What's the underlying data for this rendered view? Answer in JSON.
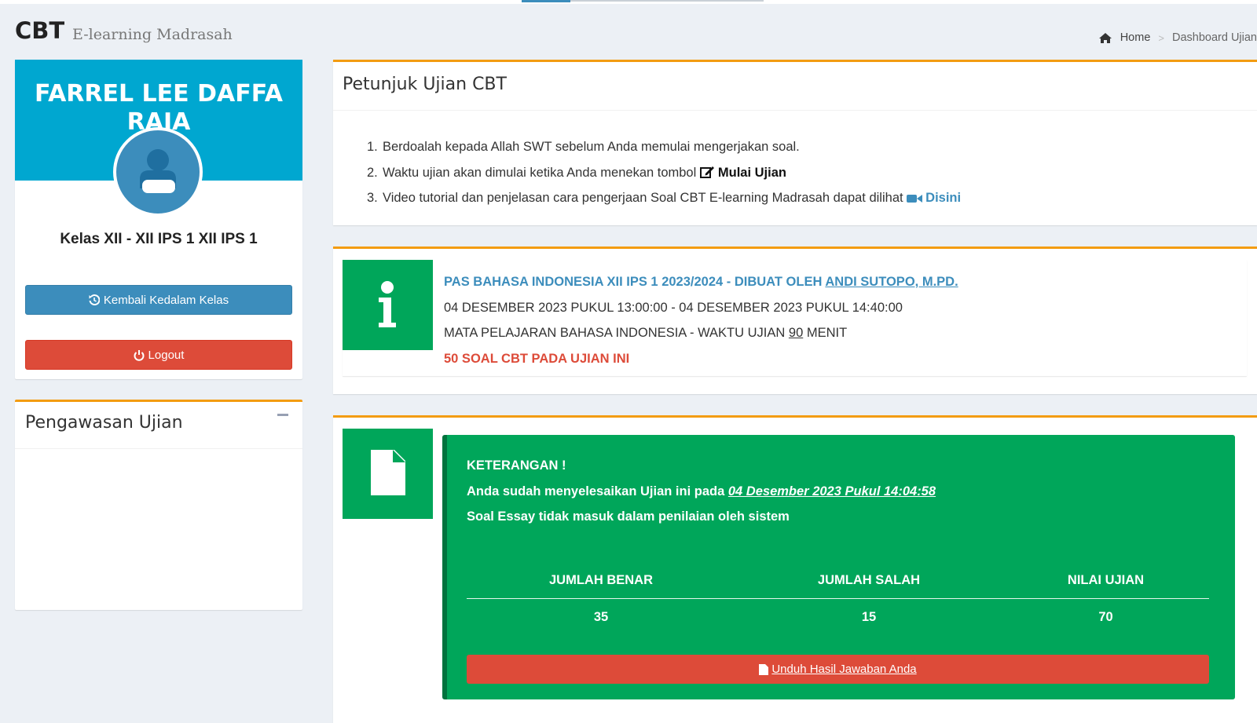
{
  "header": {
    "title": "CBT",
    "subtitle": "E-learning Madrasah",
    "breadcrumb": {
      "home": "Home",
      "separator": ">",
      "current": "Dashboard Ujian"
    }
  },
  "profile": {
    "name": "FARREL LEE DAFFA RAJA",
    "kelas": "Kelas XII - XII IPS 1 XII IPS 1",
    "back_button": "Kembali Kedalam Kelas",
    "logout_button": "Logout"
  },
  "pengawasan": {
    "title": "Pengawasan Ujian"
  },
  "petunjuk": {
    "title": "Petunjuk Ujian CBT",
    "items": [
      {
        "num": "1.",
        "text": "Berdoalah kepada Allah SWT sebelum Anda memulai mengerjakan soal."
      },
      {
        "num": "2.",
        "text": "Waktu ujian akan dimulai ketika Anda menekan tombol",
        "bold": "Mulai Ujian"
      },
      {
        "num": "3.",
        "text": "Video tutorial dan penjelasan cara pengerjaan Soal CBT E-learning Madrasah dapat dilihat",
        "link": "Disini"
      }
    ]
  },
  "exam": {
    "title": "PAS BAHASA INDONESIA XII IPS 1 2023/2024 - DIBUAT OLEH",
    "author": "ANDI SUTOPO, M.PD.",
    "schedule": "04 DESEMBER 2023 PUKUL 13:00:00 - 04 DESEMBER 2023 PUKUL 14:40:00",
    "subject_prefix": "MATA PELAJARAN BAHASA INDONESIA - WAKTU UJIAN",
    "duration": "90",
    "duration_unit": "MENIT",
    "question_count": "50 SOAL CBT PADA UJIAN INI"
  },
  "result": {
    "heading": "KETERANGAN !",
    "finished_prefix": "Anda sudah menyelesaikan Ujian ini pada",
    "finished_date": "04 Desember 2023 Pukul 14:04:58",
    "essay_note": "Soal Essay tidak masuk dalam penilaian oleh sistem",
    "columns": [
      "JUMLAH BENAR",
      "JUMLAH SALAH",
      "NILAI UJIAN"
    ],
    "values": [
      "35",
      "15",
      "70"
    ],
    "download_button": "Unduh Hasil Jawaban Anda"
  },
  "colors": {
    "primary": "#3c8dbc",
    "profile_header": "#00a7d0",
    "success": "#00a65a",
    "danger": "#dd4b39",
    "warning_border": "#f39c12",
    "background": "#ecf0f5"
  }
}
